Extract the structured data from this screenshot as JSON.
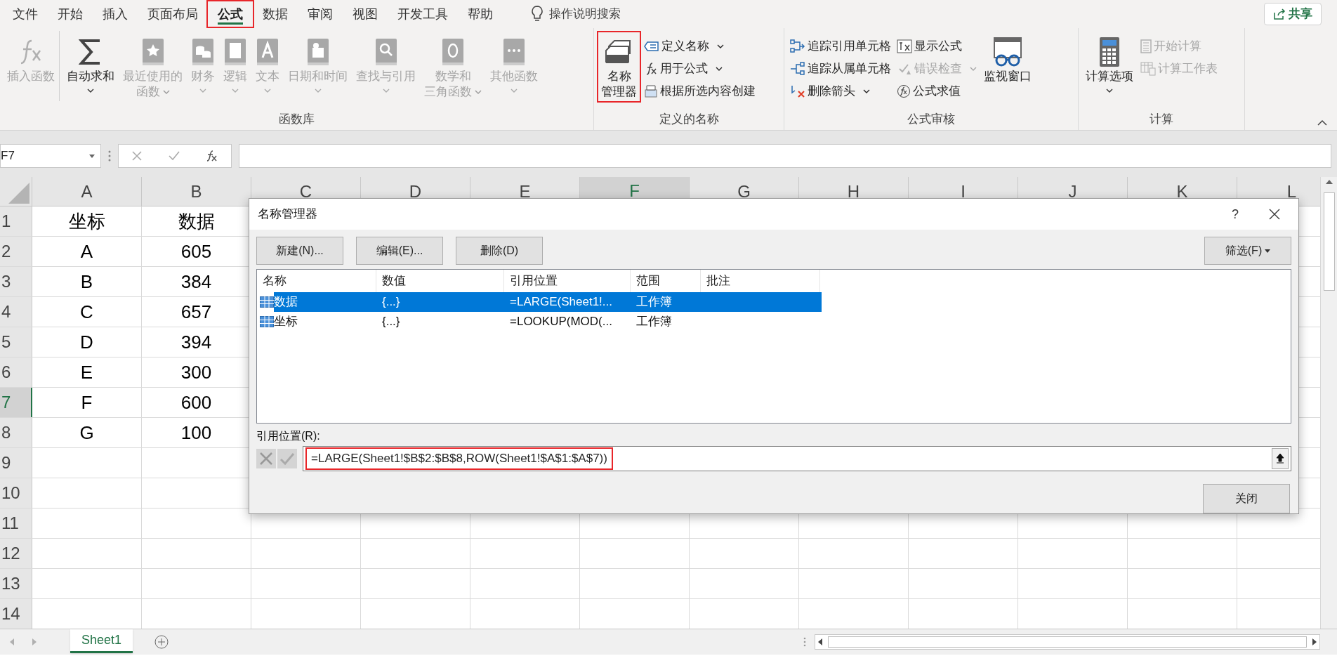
{
  "menu_tabs": [
    {
      "label": "文件",
      "selected": false,
      "highlighted": false
    },
    {
      "label": "开始",
      "selected": false,
      "highlighted": false
    },
    {
      "label": "插入",
      "selected": false,
      "highlighted": false
    },
    {
      "label": "页面布局",
      "selected": false,
      "highlighted": false
    },
    {
      "label": "公式",
      "selected": true,
      "highlighted": true
    },
    {
      "label": "数据",
      "selected": false,
      "highlighted": false
    },
    {
      "label": "审阅",
      "selected": false,
      "highlighted": false
    },
    {
      "label": "视图",
      "selected": false,
      "highlighted": false
    },
    {
      "label": "开发工具",
      "selected": false,
      "highlighted": false
    },
    {
      "label": "帮助",
      "selected": false,
      "highlighted": false
    }
  ],
  "search": {
    "placeholder": "操作说明搜索"
  },
  "share_button": "共享",
  "ribbon_groups": [
    {
      "title": "函数库",
      "items": [
        {
          "kind": "large",
          "lines": [
            "插入函数"
          ],
          "disabled": true,
          "caret": false,
          "highlighted": false
        },
        {
          "kind": "large",
          "lines": [
            "自动求和"
          ],
          "disabled": false,
          "caret": true,
          "highlighted": false
        },
        {
          "kind": "large",
          "lines": [
            "最近使用的",
            "函数"
          ],
          "disabled": true,
          "caret": true,
          "highlighted": false
        },
        {
          "kind": "large",
          "lines": [
            "财务"
          ],
          "disabled": true,
          "caret": true,
          "highlighted": false
        },
        {
          "kind": "large",
          "lines": [
            "逻辑"
          ],
          "disabled": true,
          "caret": true,
          "highlighted": false
        },
        {
          "kind": "large",
          "lines": [
            "文本"
          ],
          "disabled": true,
          "caret": true,
          "highlighted": false
        },
        {
          "kind": "large",
          "lines": [
            "日期和时间"
          ],
          "disabled": true,
          "caret": true,
          "highlighted": false
        },
        {
          "kind": "large",
          "lines": [
            "查找与引用"
          ],
          "disabled": true,
          "caret": true,
          "highlighted": false
        },
        {
          "kind": "large",
          "lines": [
            "数学和",
            "三角函数"
          ],
          "disabled": true,
          "caret": true,
          "highlighted": false
        },
        {
          "kind": "large",
          "lines": [
            "其他函数"
          ],
          "disabled": true,
          "caret": true,
          "highlighted": false
        }
      ]
    },
    {
      "title": "定义的名称",
      "items": [
        {
          "kind": "large",
          "lines": [
            "名称",
            "管理器"
          ],
          "disabled": false,
          "caret": false,
          "highlighted": true
        },
        {
          "kind": "stack",
          "items": [
            {
              "label": "定义名称",
              "disabled": false,
              "caret": true
            },
            {
              "label": "用于公式",
              "disabled": false,
              "caret": true
            },
            {
              "label": "根据所选内容创建",
              "disabled": false,
              "caret": false
            }
          ]
        }
      ]
    },
    {
      "title": "公式审核",
      "items": [
        {
          "kind": "stack",
          "items": [
            {
              "label": "追踪引用单元格",
              "disabled": false,
              "caret": false
            },
            {
              "label": "追踪从属单元格",
              "disabled": false,
              "caret": false
            },
            {
              "label": "删除箭头",
              "disabled": false,
              "caret": true
            }
          ]
        },
        {
          "kind": "stack",
          "items": [
            {
              "label": "显示公式",
              "disabled": false,
              "caret": false
            },
            {
              "label": "错误检查",
              "disabled": true,
              "caret": true
            },
            {
              "label": "公式求值",
              "disabled": false,
              "caret": false
            }
          ]
        },
        {
          "kind": "large",
          "lines": [
            "监视窗口"
          ],
          "disabled": false,
          "caret": false,
          "highlighted": false
        }
      ]
    },
    {
      "title": "计算",
      "items": [
        {
          "kind": "large",
          "lines": [
            "计算选项"
          ],
          "disabled": false,
          "caret": true,
          "highlighted": false
        },
        {
          "kind": "stack",
          "items": [
            {
              "label": "开始计算",
              "disabled": true,
              "caret": false
            },
            {
              "label": "计算工作表",
              "disabled": true,
              "caret": false
            }
          ]
        }
      ]
    }
  ],
  "formula_bar": {
    "name_box": "F7"
  },
  "sheet": {
    "columns": [
      {
        "label": "A",
        "selected": false
      },
      {
        "label": "B",
        "selected": false
      },
      {
        "label": "C",
        "selected": false
      },
      {
        "label": "D",
        "selected": false
      },
      {
        "label": "E",
        "selected": false
      },
      {
        "label": "F",
        "selected": true
      },
      {
        "label": "G",
        "selected": false
      },
      {
        "label": "H",
        "selected": false
      },
      {
        "label": "I",
        "selected": false
      },
      {
        "label": "J",
        "selected": false
      },
      {
        "label": "K",
        "selected": false
      },
      {
        "label": "L",
        "selected": false
      }
    ],
    "rows": [
      {
        "label": "1",
        "selected": false,
        "cells": [
          "坐标",
          "数据"
        ]
      },
      {
        "label": "2",
        "selected": false,
        "cells": [
          "A",
          "605"
        ]
      },
      {
        "label": "3",
        "selected": false,
        "cells": [
          "B",
          "384"
        ]
      },
      {
        "label": "4",
        "selected": false,
        "cells": [
          "C",
          "657"
        ]
      },
      {
        "label": "5",
        "selected": false,
        "cells": [
          "D",
          "394"
        ]
      },
      {
        "label": "6",
        "selected": false,
        "cells": [
          "E",
          "300"
        ]
      },
      {
        "label": "7",
        "selected": true,
        "cells": [
          "F",
          "600"
        ]
      },
      {
        "label": "8",
        "selected": false,
        "cells": [
          "G",
          "100"
        ]
      },
      {
        "label": "9",
        "selected": false
      },
      {
        "label": "10",
        "selected": false
      },
      {
        "label": "11",
        "selected": false
      },
      {
        "label": "12",
        "selected": false
      },
      {
        "label": "13",
        "selected": false
      },
      {
        "label": "14",
        "selected": false
      }
    ]
  },
  "dialog": {
    "title": "名称管理器",
    "help": "?",
    "buttons": [
      "新建(N)...",
      "编辑(E)...",
      "删除(D)"
    ],
    "filter_button": "筛选(F)",
    "columns": [
      "名称",
      "数值",
      "引用位置",
      "范围",
      "批注"
    ],
    "rows": [
      {
        "name": "数据",
        "value": "{...}",
        "refers_to": "=LARGE(Sheet1!...",
        "scope": "工作簿",
        "selected": true
      },
      {
        "name": "坐标",
        "value": "{...}",
        "refers_to": "=LOOKUP(MOD(...",
        "scope": "工作簿",
        "selected": false
      }
    ],
    "refers_label": "引用位置(R):",
    "refers_value": "=LARGE(Sheet1!$B$2:$B$8,ROW(Sheet1!$A$1:$A$7))",
    "refers_highlighted": true,
    "close_button": "关闭"
  },
  "sheet_tabs": [
    {
      "label": "Sheet1",
      "selected": true
    }
  ]
}
